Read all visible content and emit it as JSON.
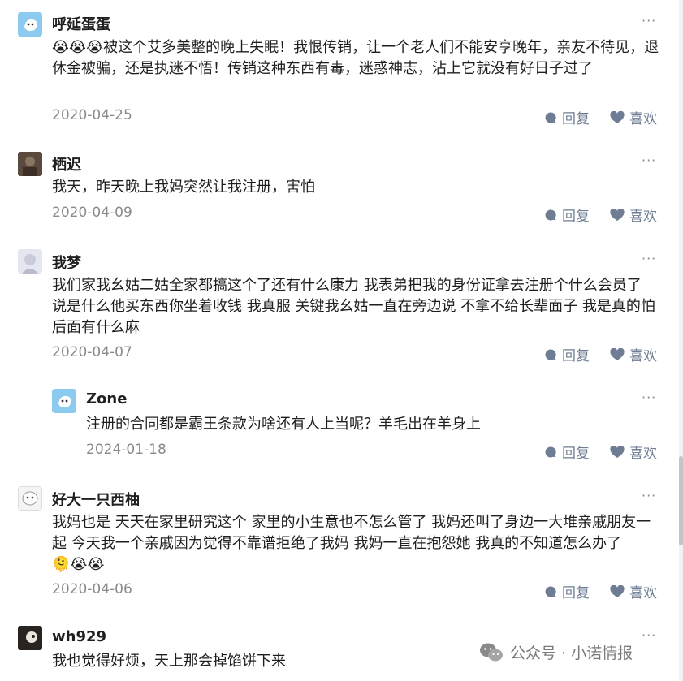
{
  "actions": {
    "reply": "回复",
    "like": "喜欢"
  },
  "comments": [
    {
      "nick": "呼延蛋蛋",
      "emoji": "😭😭😭",
      "text": "被这个艾多美整的晚上失眠！我恨传销，让一个老人们不能安享晚年，亲友不待见，退休金被骗，还是执迷不悟！传销这种东西有毒，迷惑神志，沾上它就没有好日子过了",
      "date": "2020-04-25"
    },
    {
      "nick": "栖迟",
      "text": "我天，昨天晚上我妈突然让我注册，害怕",
      "date": "2020-04-09"
    },
    {
      "nick": "我梦",
      "text": "我们家我幺姑二姑全家都搞这个了还有什么康力 我表弟把我的身份证拿去注册个什么会员了 说是什么他买东西你坐着收钱 我真服 关键我幺姑一直在旁边说 不拿不给长辈面子 我是真的怕后面有什么麻",
      "date": "2020-04-07"
    },
    {
      "nick": "Zone",
      "text": "注册的合同都是霸王条款为啥还有人上当呢？羊毛出在羊身上",
      "date": "2024-01-18"
    },
    {
      "nick": "好大一只西柚",
      "text": "我妈也是 天天在家里研究这个 家里的小生意也不怎么管了 我妈还叫了身边一大堆亲戚朋友一起 今天我一个亲戚因为觉得不靠谱拒绝了我妈 我妈一直在抱怨她 我真的不知道怎么办了",
      "emoji": "🫠😭😭",
      "date": "2020-04-06"
    },
    {
      "nick": "wh929",
      "text": "我也觉得好烦，天上那会掉馅饼下来"
    }
  ],
  "more_icon": "···",
  "watermark": "公众号 · 小诺情报"
}
